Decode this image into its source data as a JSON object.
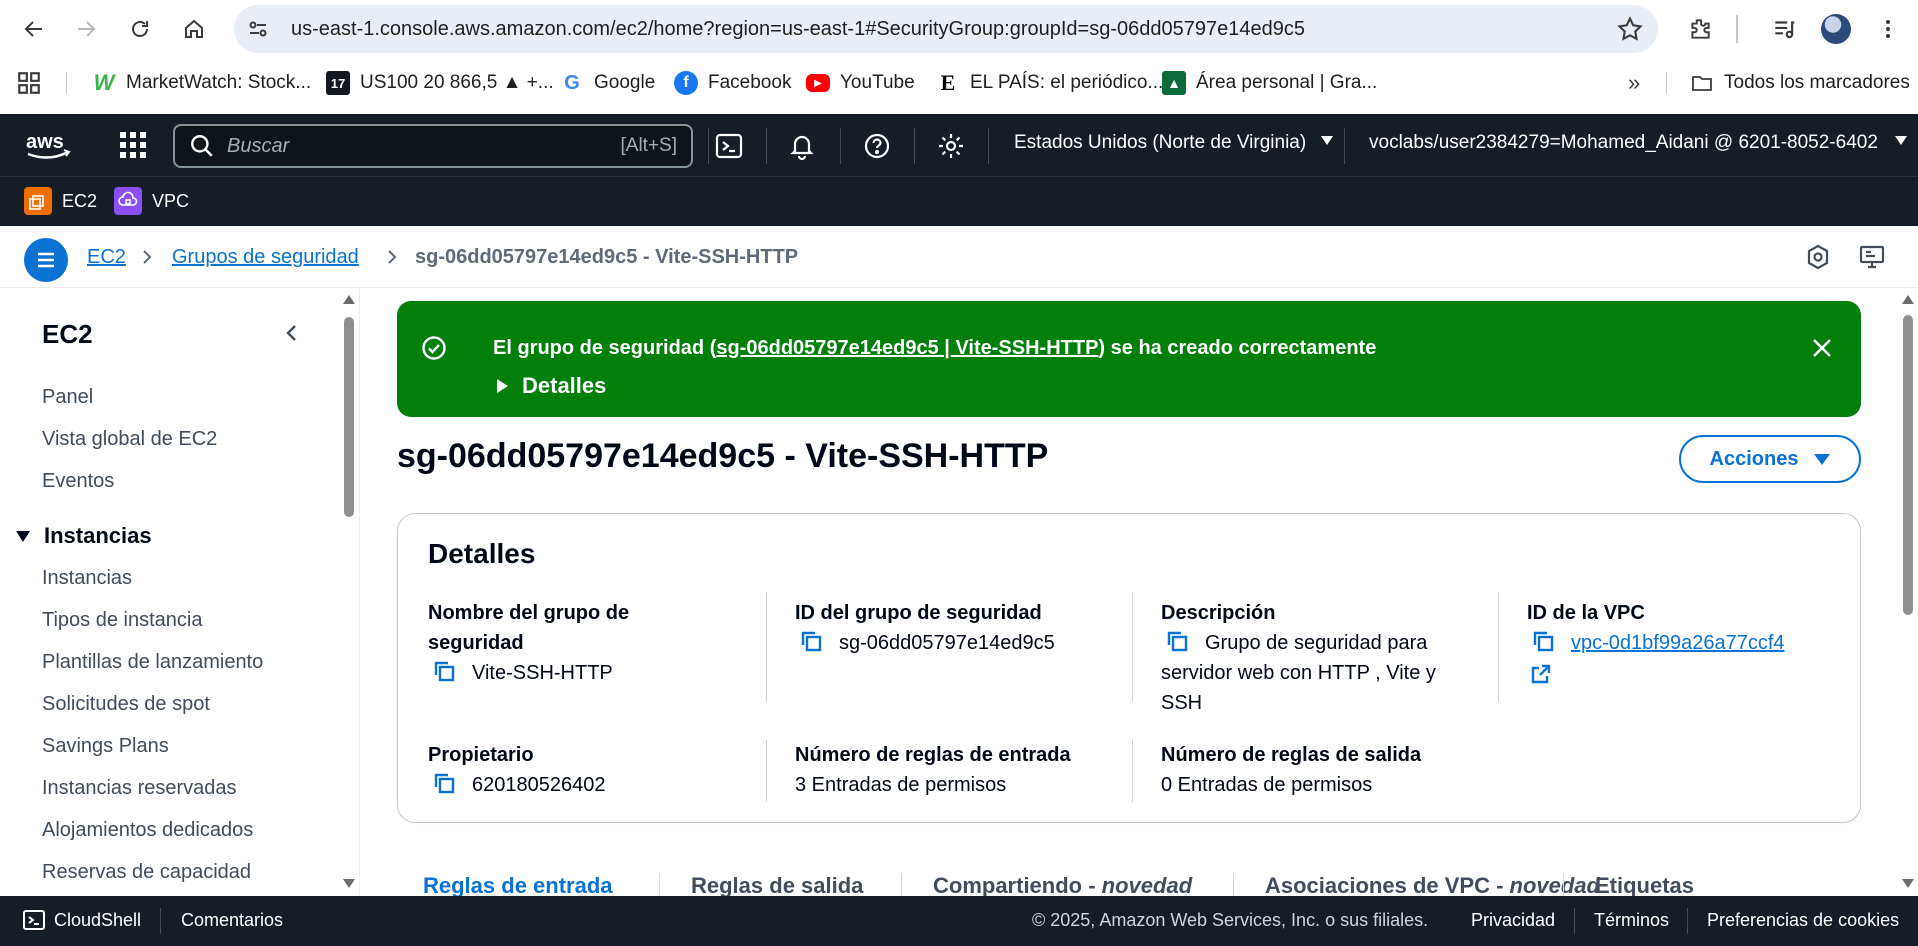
{
  "browser": {
    "url": "us-east-1.console.aws.amazon.com/ec2/home?region=us-east-1#SecurityGroup:groupId=sg-06dd05797e14ed9c5",
    "bookmarks": [
      {
        "label": "MarketWatch: Stock...",
        "icon": "marketwatch-icon"
      },
      {
        "label": "US100 20 866,5 ▲ +...",
        "icon": "tradingview-icon"
      },
      {
        "label": "Google",
        "icon": "google-icon"
      },
      {
        "label": "Facebook",
        "icon": "facebook-icon"
      },
      {
        "label": "YouTube",
        "icon": "youtube-icon"
      },
      {
        "label": "EL PAÍS: el periódico...",
        "icon": "elpais-icon"
      },
      {
        "label": "Área personal | Gra...",
        "icon": "area-personal-icon"
      }
    ],
    "all_bookmarks_label": "Todos los marcadores"
  },
  "aws_nav": {
    "search_placeholder": "Buscar",
    "search_shortcut": "[Alt+S]",
    "region": "Estados Unidos (Norte de Virginia)",
    "account": "voclabs/user2384279=Mohamed_Aidani @ 6201-8052-6402",
    "favorites": [
      {
        "label": "EC2",
        "color": "#ed7100"
      },
      {
        "label": "VPC",
        "color": "#8c4fff"
      }
    ]
  },
  "breadcrumb": {
    "items": [
      "EC2",
      "Grupos de seguridad"
    ],
    "current": "sg-06dd05797e14ed9c5 - Vite-SSH-HTTP"
  },
  "sidenav": {
    "title": "EC2",
    "top_items": [
      "Panel",
      "Vista global de EC2",
      "Eventos"
    ],
    "section": "Instancias",
    "section_items": [
      "Instancias",
      "Tipos de instancia",
      "Plantillas de lanzamiento",
      "Solicitudes de spot",
      "Savings Plans",
      "Instancias reservadas",
      "Alojamientos dedicados",
      "Reservas de capacidad"
    ]
  },
  "flash": {
    "prefix": "El grupo de seguridad (",
    "link": "sg-06dd05797e14ed9c5 | Vite-SSH-HTTP",
    "suffix": ") se ha creado correctamente",
    "details_label": "Detalles",
    "color": "#037f0c"
  },
  "page": {
    "title": "sg-06dd05797e14ed9c5 - Vite-SSH-HTTP",
    "actions_label": "Acciones"
  },
  "details": {
    "title": "Detalles",
    "name_label": "Nombre del grupo de seguridad",
    "name_value": "Vite-SSH-HTTP",
    "id_label": "ID del grupo de seguridad",
    "id_value": "sg-06dd05797e14ed9c5",
    "desc_label": "Descripción",
    "desc_value": "Grupo de seguridad para servidor web con HTTP , Vite y SSH",
    "vpc_label": "ID de la VPC",
    "vpc_value": "vpc-0d1bf99a26a77ccf4",
    "owner_label": "Propietario",
    "owner_value": "620180526402",
    "inbound_label": "Número de reglas de entrada",
    "inbound_value": "3 Entradas de permisos",
    "outbound_label": "Número de reglas de salida",
    "outbound_value": "0 Entradas de permisos"
  },
  "tabs": [
    {
      "label": "Reglas de entrada",
      "tag": ""
    },
    {
      "label": "Reglas de salida",
      "tag": ""
    },
    {
      "label": "Compartiendo - ",
      "tag": "novedad"
    },
    {
      "label": "Asociaciones de VPC - ",
      "tag": "novedad"
    },
    {
      "label": "Etiquetas",
      "tag": ""
    }
  ],
  "footer": {
    "cloudshell": "CloudShell",
    "feedback": "Comentarios",
    "copyright": "© 2025, Amazon Web Services, Inc. o sus filiales.",
    "privacy": "Privacidad",
    "terms": "Términos",
    "cookies": "Preferencias de cookies"
  }
}
